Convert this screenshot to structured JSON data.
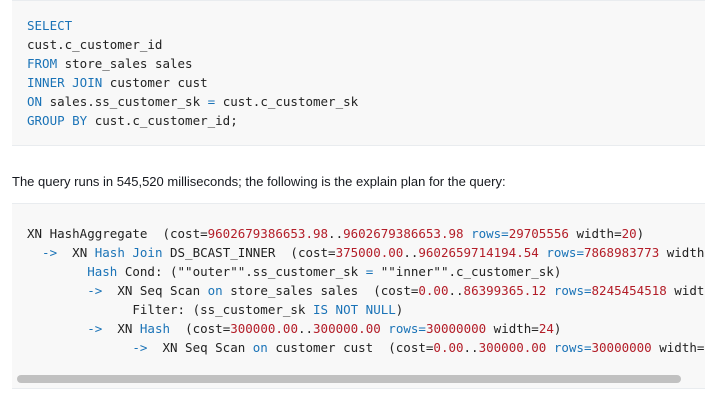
{
  "sql": {
    "lines": [
      [
        {
          "t": "SELECT",
          "k": "kw"
        }
      ],
      [
        {
          "t": "cust.c_customer_id",
          "k": ""
        }
      ],
      [
        {
          "t": "FROM",
          "k": "kw"
        },
        {
          "t": " store_sales sales",
          "k": ""
        }
      ],
      [
        {
          "t": "INNER JOIN",
          "k": "kw"
        },
        {
          "t": " customer cust",
          "k": ""
        }
      ],
      [
        {
          "t": "ON",
          "k": "kw"
        },
        {
          "t": " sales.ss_customer_sk ",
          "k": ""
        },
        {
          "t": "=",
          "k": "op"
        },
        {
          "t": " cust.c_customer_sk",
          "k": ""
        }
      ],
      [
        {
          "t": "GROUP BY",
          "k": "kw"
        },
        {
          "t": " cust.c_customer_id;",
          "k": ""
        }
      ]
    ]
  },
  "prose": {
    "text": "The query runs in 545,520 milliseconds; the following is the explain plan for the query:"
  },
  "plan": {
    "lines": [
      [
        {
          "t": "XN HashAggregate  (cost=",
          "k": ""
        },
        {
          "t": "9602679386653.98",
          "k": "num"
        },
        {
          "t": "..",
          "k": ""
        },
        {
          "t": "9602679386653.98",
          "k": "num"
        },
        {
          "t": " ",
          "k": ""
        },
        {
          "t": "rows",
          "k": "kw"
        },
        {
          "t": "=",
          "k": "op"
        },
        {
          "t": "29705556",
          "k": "num"
        },
        {
          "t": " width=",
          "k": ""
        },
        {
          "t": "20",
          "k": "num"
        },
        {
          "t": ")",
          "k": ""
        }
      ],
      [
        {
          "t": "  -> ",
          "k": "op"
        },
        {
          "t": " XN ",
          "k": ""
        },
        {
          "t": "Hash Join",
          "k": "kw"
        },
        {
          "t": " DS_BCAST_INNER  (cost=",
          "k": ""
        },
        {
          "t": "375000.00",
          "k": "num"
        },
        {
          "t": "..",
          "k": ""
        },
        {
          "t": "9602659714194.54",
          "k": "num"
        },
        {
          "t": " ",
          "k": ""
        },
        {
          "t": "rows",
          "k": "kw"
        },
        {
          "t": "=",
          "k": "op"
        },
        {
          "t": "7868983773",
          "k": "num"
        },
        {
          "t": " width",
          "k": ""
        }
      ],
      [
        {
          "t": "        ",
          "k": ""
        },
        {
          "t": "Hash",
          "k": "kw"
        },
        {
          "t": " Cond: (\"\"outer\"\".ss_customer_sk ",
          "k": ""
        },
        {
          "t": "=",
          "k": "op"
        },
        {
          "t": " \"\"inner\"\".c_customer_sk)",
          "k": ""
        }
      ],
      [
        {
          "t": "        -> ",
          "k": "op"
        },
        {
          "t": " XN Seq Scan ",
          "k": ""
        },
        {
          "t": "on",
          "k": "kw"
        },
        {
          "t": " store_sales sales  (cost=",
          "k": ""
        },
        {
          "t": "0.00",
          "k": "num"
        },
        {
          "t": "..",
          "k": ""
        },
        {
          "t": "86399365.12",
          "k": "num"
        },
        {
          "t": " ",
          "k": ""
        },
        {
          "t": "rows",
          "k": "kw"
        },
        {
          "t": "=",
          "k": "op"
        },
        {
          "t": "8245454518",
          "k": "num"
        },
        {
          "t": " widt",
          "k": ""
        }
      ],
      [
        {
          "t": "              Filter: (ss_customer_sk ",
          "k": ""
        },
        {
          "t": "IS NOT NULL",
          "k": "kw"
        },
        {
          "t": ")",
          "k": ""
        }
      ],
      [
        {
          "t": "        -> ",
          "k": "op"
        },
        {
          "t": " XN ",
          "k": ""
        },
        {
          "t": "Hash",
          "k": "kw"
        },
        {
          "t": "  (cost=",
          "k": ""
        },
        {
          "t": "300000.00",
          "k": "num"
        },
        {
          "t": "..",
          "k": ""
        },
        {
          "t": "300000.00",
          "k": "num"
        },
        {
          "t": " ",
          "k": ""
        },
        {
          "t": "rows",
          "k": "kw"
        },
        {
          "t": "=",
          "k": "op"
        },
        {
          "t": "30000000",
          "k": "num"
        },
        {
          "t": " width=",
          "k": ""
        },
        {
          "t": "24",
          "k": "num"
        },
        {
          "t": ")",
          "k": ""
        }
      ],
      [
        {
          "t": "              -> ",
          "k": "op"
        },
        {
          "t": " XN Seq Scan ",
          "k": ""
        },
        {
          "t": "on",
          "k": "kw"
        },
        {
          "t": " customer cust  (cost=",
          "k": ""
        },
        {
          "t": "0.00",
          "k": "num"
        },
        {
          "t": "..",
          "k": ""
        },
        {
          "t": "300000.00",
          "k": "num"
        },
        {
          "t": " ",
          "k": ""
        },
        {
          "t": "rows",
          "k": "kw"
        },
        {
          "t": "=",
          "k": "op"
        },
        {
          "t": "30000000",
          "k": "num"
        },
        {
          "t": " width=",
          "k": ""
        }
      ]
    ]
  }
}
